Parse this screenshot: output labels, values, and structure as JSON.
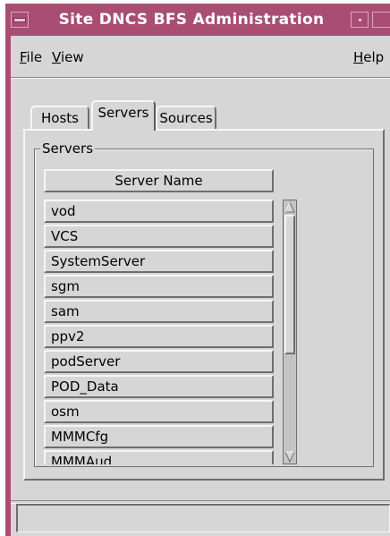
{
  "window": {
    "title": "Site DNCS BFS Administration",
    "frame_color": "#a94d73"
  },
  "menubar": {
    "file_label": "File",
    "file_rest": "ile",
    "file_mnemonic": "F",
    "view_mnemonic": "V",
    "view_rest": "iew",
    "help_mnemonic": "H",
    "help_rest": "elp"
  },
  "tabs": [
    {
      "label": "Hosts"
    },
    {
      "label": "Servers",
      "active": true
    },
    {
      "label": "Sources"
    }
  ],
  "servers_group": {
    "label": "Servers",
    "column_header": "Server Name",
    "rows": [
      "vod",
      "VCS",
      "SystemServer",
      "sgm",
      "sam",
      "ppv2",
      "podServer",
      "POD_Data",
      "osm",
      "MMMCfg",
      "MMMAud"
    ]
  },
  "status": {
    "text": ""
  },
  "icons": [
    "window-menu-icon",
    "minimize-icon",
    "maximize-icon",
    "scroll-up-arrow-icon",
    "scroll-down-arrow-icon"
  ]
}
